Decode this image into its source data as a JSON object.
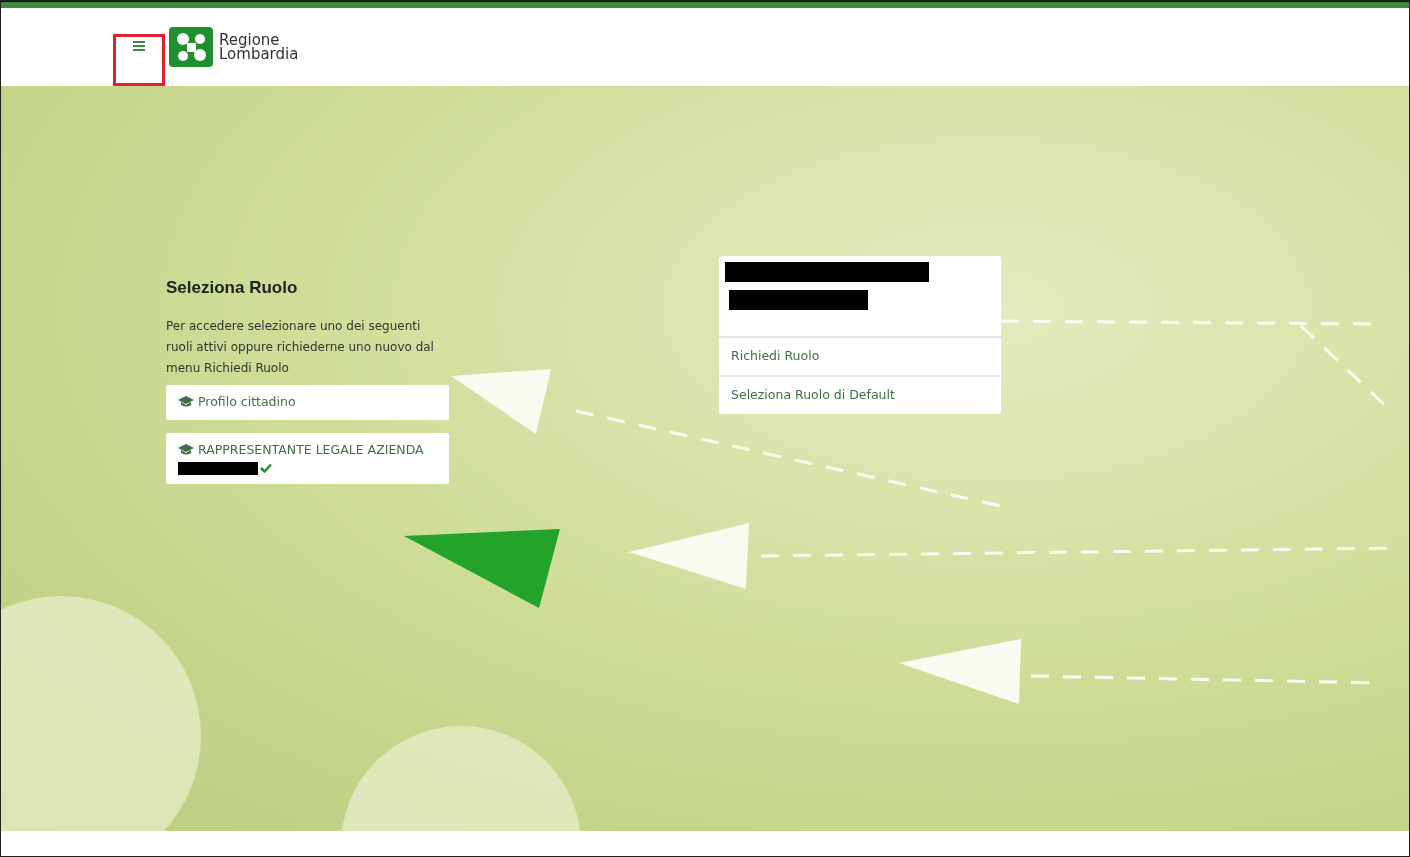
{
  "header": {
    "logo_line_1": "Regione",
    "logo_line_2": "Lombardia",
    "menu_highlighted": true
  },
  "role_panel": {
    "title": "Seleziona Ruolo",
    "description": "Per accedere selezionare uno dei seguenti ruoli attivi oppure richiederne uno nuovo dal menu Richiedi Ruolo",
    "roles": [
      {
        "label": "Profilo cittadino",
        "verified": false,
        "redacted_detail": false
      },
      {
        "label": "RAPPRESENTANTE LEGALE AZIENDA",
        "verified": true,
        "redacted_detail": true
      }
    ]
  },
  "user_menu": {
    "items": [
      "Richiedi Ruolo",
      "Seleziona Ruolo di Default"
    ]
  }
}
